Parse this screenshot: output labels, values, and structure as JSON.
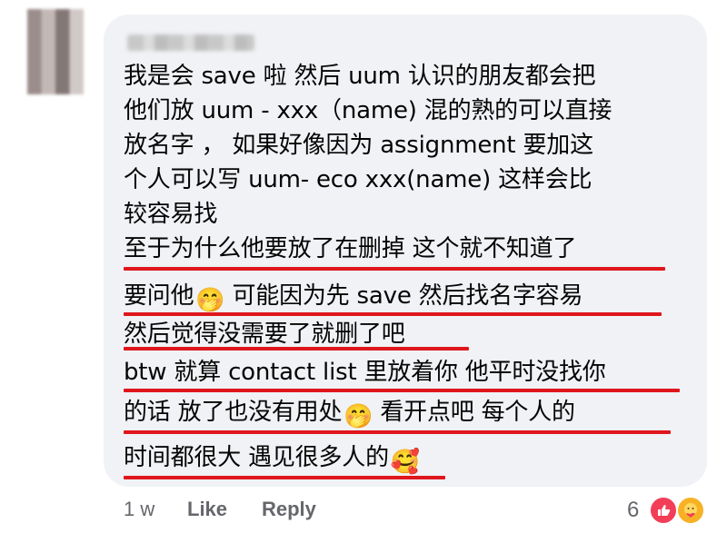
{
  "comment": {
    "lines": [
      "我是会 save 啦 然后 uum 认识的朋友都会把",
      "他们放 uum - xxx（name) 混的熟的可以直接",
      "放名字 ， 如果好像因为 assignment 要加这",
      "个人可以写 uum- eco xxx(name) 这样会比",
      "较容易找",
      "至于为什么他要放了在删掉 这个就不知道了",
      "要问他",
      "可能因为先 save 然后找名字容易",
      "然后觉得没需要了就删了吧",
      "btw 就算 contact list 里放着你 他平时没找你",
      "的话 放了也没有用处",
      "看开点吧 每个人的",
      "时间都很大 遇见很多人的"
    ],
    "emojis": {
      "hand_over_mouth": "🤭",
      "smiling_hearts": "🥰"
    }
  },
  "footer": {
    "time": "1 w",
    "like": "Like",
    "reply": "Reply",
    "reaction_count": "6"
  },
  "colors": {
    "bubble": "#f0f2f5",
    "underline": "#e0161d",
    "meta": "#65676b"
  }
}
